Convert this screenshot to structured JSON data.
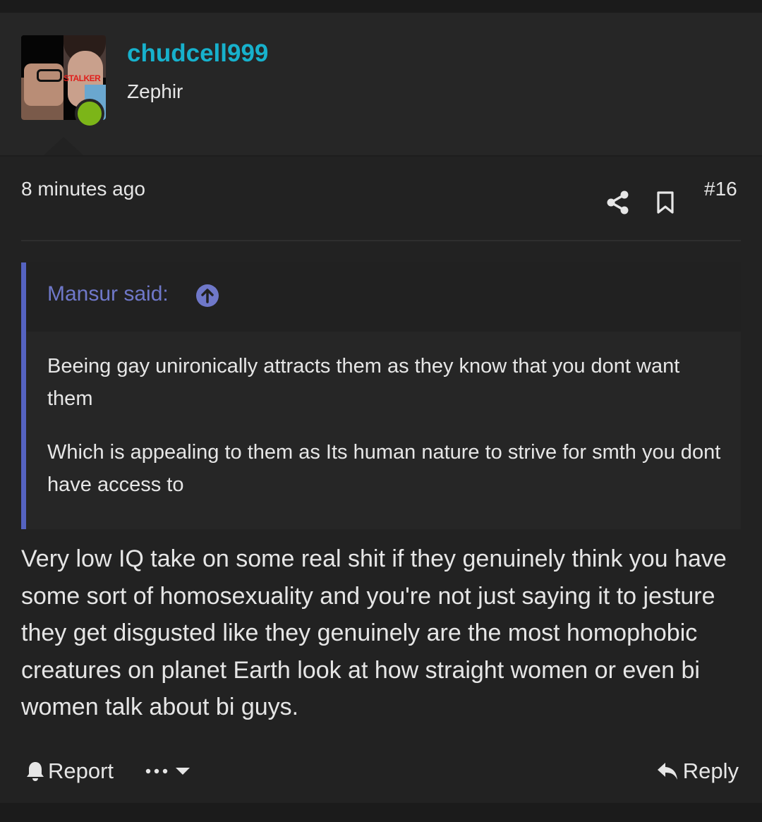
{
  "post": {
    "author": {
      "username": "chudcell999",
      "title": "Zephir",
      "avatar_text": "STALKER",
      "online": true
    },
    "time": "8 minutes ago",
    "number": "#16",
    "quote": {
      "author_label": "Mansur said:",
      "paragraphs": [
        "Beeing gay unironically attracts them as they know that you dont want them",
        "Which is appealing to them as Its human nature to strive for smth you dont have access to"
      ]
    },
    "message": "Very low IQ take on some real shit if they genuinely think you have some sort of homosexuality and you're not just saying it to jesture they get disgusted like they genuinely are the most homophobic creatures on planet Earth look at how straight women or even bi women talk about bi guys.",
    "actions": {
      "report_label": "Report",
      "reply_label": "Reply",
      "more_label": "•••"
    }
  },
  "colors": {
    "username": "#17b1cc",
    "quote_accent": "#5563c1",
    "quote_author": "#6f78c9",
    "online": "#7cb518",
    "background": "#222222"
  },
  "icons": {
    "share": "share-icon",
    "bookmark": "bookmark-icon",
    "quote_jump": "arrow-up-circle-icon",
    "report": "bell-icon",
    "more": "ellipsis-icon",
    "dropdown": "caret-down-icon",
    "reply": "reply-arrow-icon"
  }
}
